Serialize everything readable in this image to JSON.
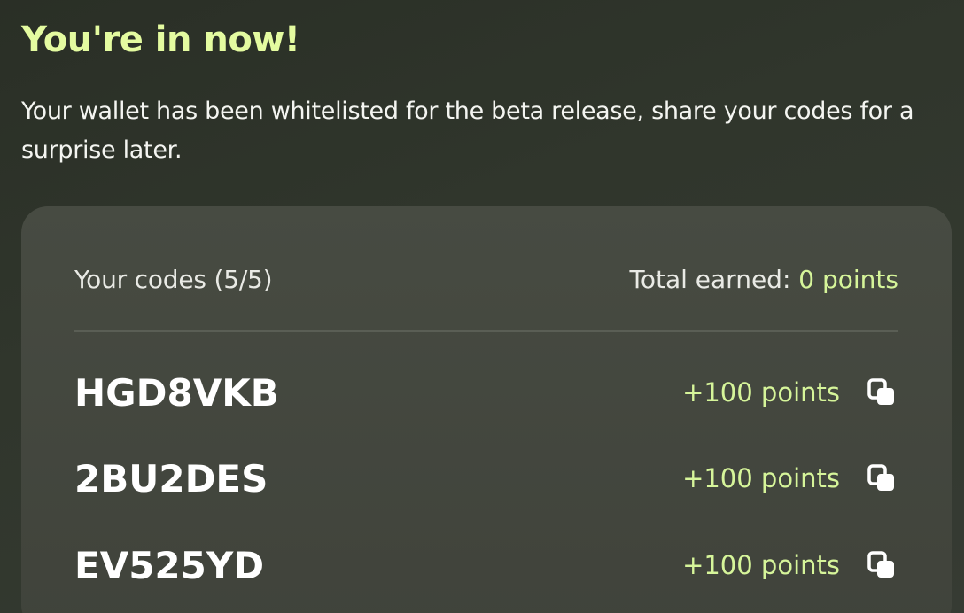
{
  "header": {
    "title": "You're in now!",
    "subtitle": "Your wallet has been whitelisted for the beta release, share your codes for a surprise later."
  },
  "codes_card": {
    "count_label": "Your codes (5/5)",
    "total_label": "Total earned: ",
    "total_value": "0 points",
    "items": [
      {
        "code": "HGD8VKB",
        "points": "+100 points",
        "icon": "copy-icon"
      },
      {
        "code": "2BU2DES",
        "points": "+100 points",
        "icon": "copy-icon"
      },
      {
        "code": "EV525YD",
        "points": "+100 points",
        "icon": "copy-icon"
      }
    ]
  },
  "colors": {
    "accent": "#d6f59a",
    "heading": "#e4fba0",
    "card_bg": "#474b42",
    "page_bg": "#2e3329"
  }
}
